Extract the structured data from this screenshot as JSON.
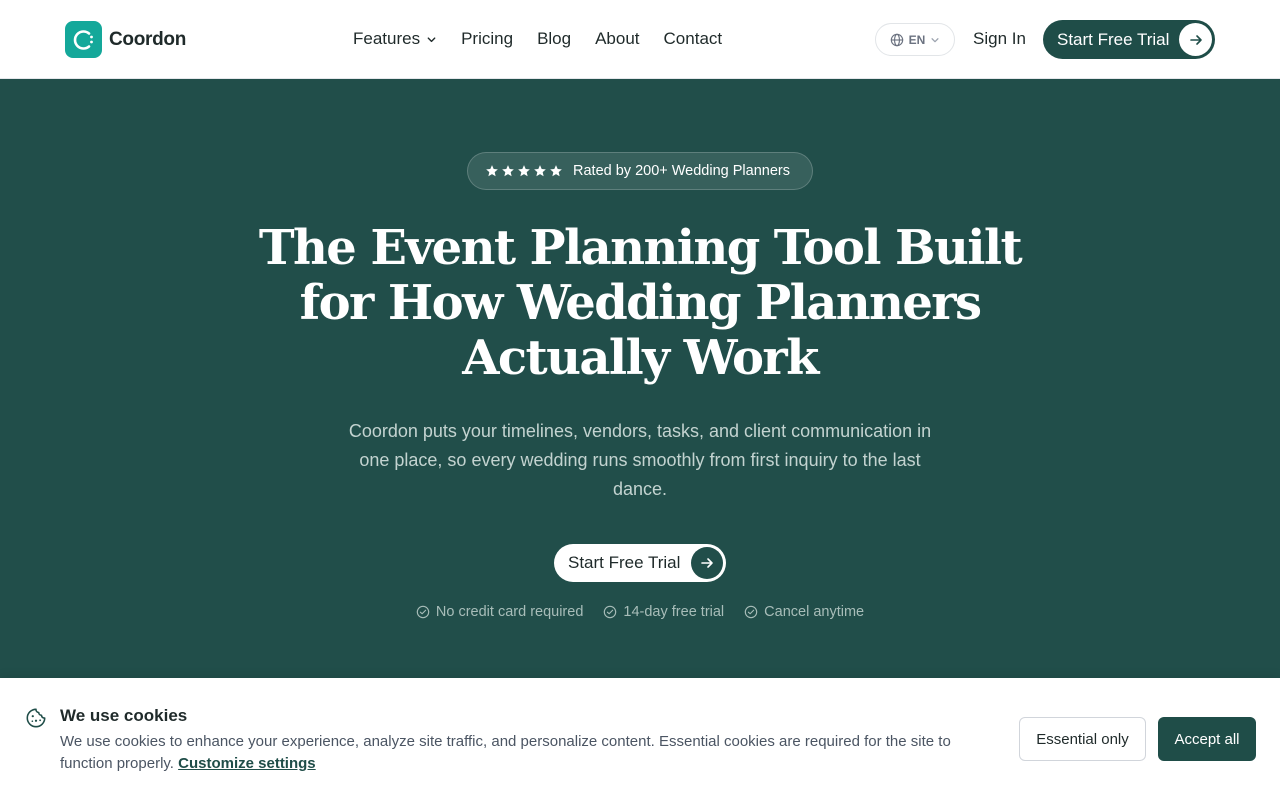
{
  "brand": {
    "name": "Coordon",
    "accent": "#14a89a",
    "dark": "#1f4d48",
    "hero_bg": "#214e4a"
  },
  "nav": {
    "items": [
      {
        "label": "Features",
        "has_dropdown": true
      },
      {
        "label": "Pricing"
      },
      {
        "label": "Blog"
      },
      {
        "label": "About"
      },
      {
        "label": "Contact"
      }
    ],
    "language": "EN",
    "sign_in": "Sign In",
    "cta": "Start Free Trial"
  },
  "hero": {
    "rating_text": "Rated by 200+ Wedding Planners",
    "rating_stars": 5,
    "headline": "The Event Planning Tool Built for How Wedding Planners Actually Work",
    "subheadline": "Coordon puts your timelines, vendors, tasks, and client communication in one place, so every wedding runs smoothly from first inquiry to the last dance.",
    "cta": "Start Free Trial",
    "perks": [
      "No credit card required",
      "14-day free trial",
      "Cancel anytime"
    ]
  },
  "cookie": {
    "title": "We use cookies",
    "text": "We use cookies to enhance your experience, analyze site traffic, and personalize content. Essential cookies are required for the site to function properly.",
    "link": "Customize settings",
    "essential_button": "Essential only",
    "accept_button": "Accept all"
  }
}
